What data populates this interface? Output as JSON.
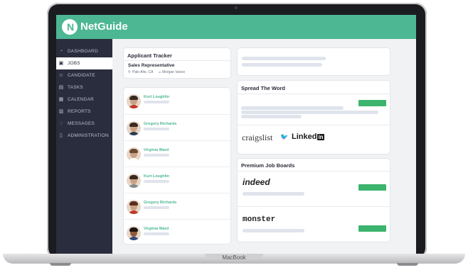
{
  "app": {
    "brand": "NetGuide",
    "accent": "#4db793",
    "sidebar_color": "#2a2d3d",
    "button_green": "#3db46d"
  },
  "device": {
    "label": "MacBook"
  },
  "sidebar": {
    "items": [
      {
        "label": "DASHBOARD",
        "icon": "dashboard-icon",
        "active": false
      },
      {
        "label": "JOBS",
        "icon": "briefcase-icon",
        "active": true
      },
      {
        "label": "CANDIDATE",
        "icon": "person-icon",
        "active": false
      },
      {
        "label": "TASKS",
        "icon": "clipboard-icon",
        "active": false
      },
      {
        "label": "CALENDAR",
        "icon": "calendar-icon",
        "active": false
      },
      {
        "label": "REPORTS",
        "icon": "chart-icon",
        "active": false
      },
      {
        "label": "MESSAGES",
        "icon": "chat-icon",
        "active": false
      },
      {
        "label": "ADMINISTRATION",
        "icon": "document-icon",
        "active": false
      }
    ]
  },
  "tracker": {
    "title": "Applicant Tracker",
    "job_title": "Sales Representative",
    "location": "Palo Alto, CA",
    "owner": "Morgan Vance",
    "applicants": [
      {
        "name": "Kurt Loughlin"
      },
      {
        "name": "Gregory Richards"
      },
      {
        "name": "Virginia Ward"
      },
      {
        "name": "Kurt Loughlin"
      },
      {
        "name": "Gregory Richards"
      },
      {
        "name": "Virginia Ward"
      }
    ]
  },
  "spread": {
    "title": "Spread The Word",
    "logos": {
      "craigslist": "craigslist",
      "linkedin": "Linked",
      "linkedin_in": "in"
    }
  },
  "boards": {
    "title": "Premium Job Boards",
    "items": [
      {
        "name": "indeed"
      },
      {
        "name": "monster"
      }
    ]
  }
}
